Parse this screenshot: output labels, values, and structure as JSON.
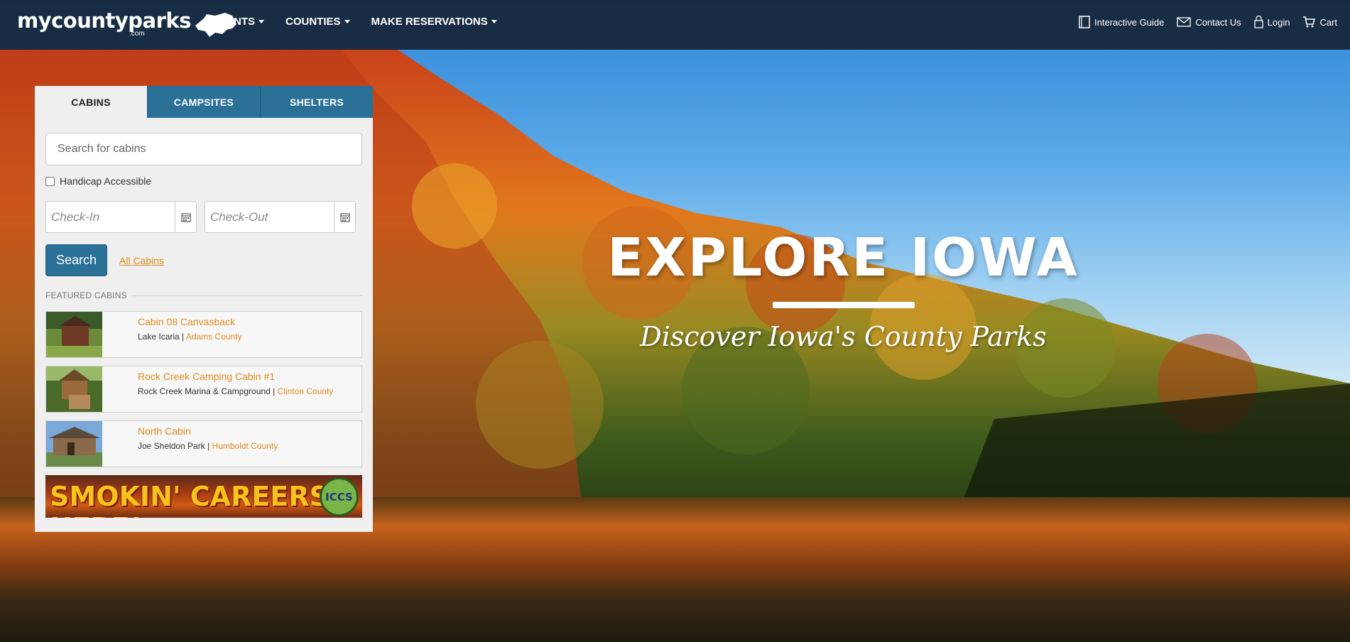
{
  "colors": {
    "brand_blue": "#2a7097",
    "accent_orange": "#e08a1e",
    "nav_bg": "#162638"
  },
  "nav": {
    "logo_text": "mycountyparks",
    "logo_sub": ".com",
    "menu": [
      {
        "label": "EVENTS"
      },
      {
        "label": "COUNTIES"
      },
      {
        "label": "MAKE RESERVATIONS"
      }
    ],
    "right_links": [
      {
        "label": "Interactive Guide",
        "icon": "book-icon"
      },
      {
        "label": "Contact Us",
        "icon": "envelope-icon"
      },
      {
        "label": "Login",
        "icon": "lock-icon"
      },
      {
        "label": "Cart",
        "icon": "cart-icon"
      }
    ]
  },
  "hero": {
    "title": "EXPLORE IOWA",
    "subtitle": "Discover Iowa's County Parks"
  },
  "panel": {
    "tabs": [
      {
        "label": "CABINS",
        "active": true
      },
      {
        "label": "CAMPSITES",
        "active": false
      },
      {
        "label": "SHELTERS",
        "active": false
      }
    ],
    "search_placeholder": "Search for cabins",
    "handicap_label": "Handicap Accessible",
    "checkin_placeholder": "Check-In",
    "checkout_placeholder": "Check-Out",
    "search_button": "Search",
    "all_link": "All Cabins",
    "featured_heading": "FEATURED CABINS",
    "featured": [
      {
        "title": "Cabin 08 Canvasback",
        "park": "Lake Icaria",
        "county": "Adams County"
      },
      {
        "title": "Rock Creek Camping Cabin #1",
        "park": "Rock Creek Marina & Campground",
        "county": "Clinton County"
      },
      {
        "title": "North Cabin",
        "park": "Joe Sheldon Park",
        "county": "Humboldt County"
      }
    ],
    "banner": {
      "text": "SMOKIN' CAREERS HERE!",
      "badge": "ICCS"
    }
  }
}
